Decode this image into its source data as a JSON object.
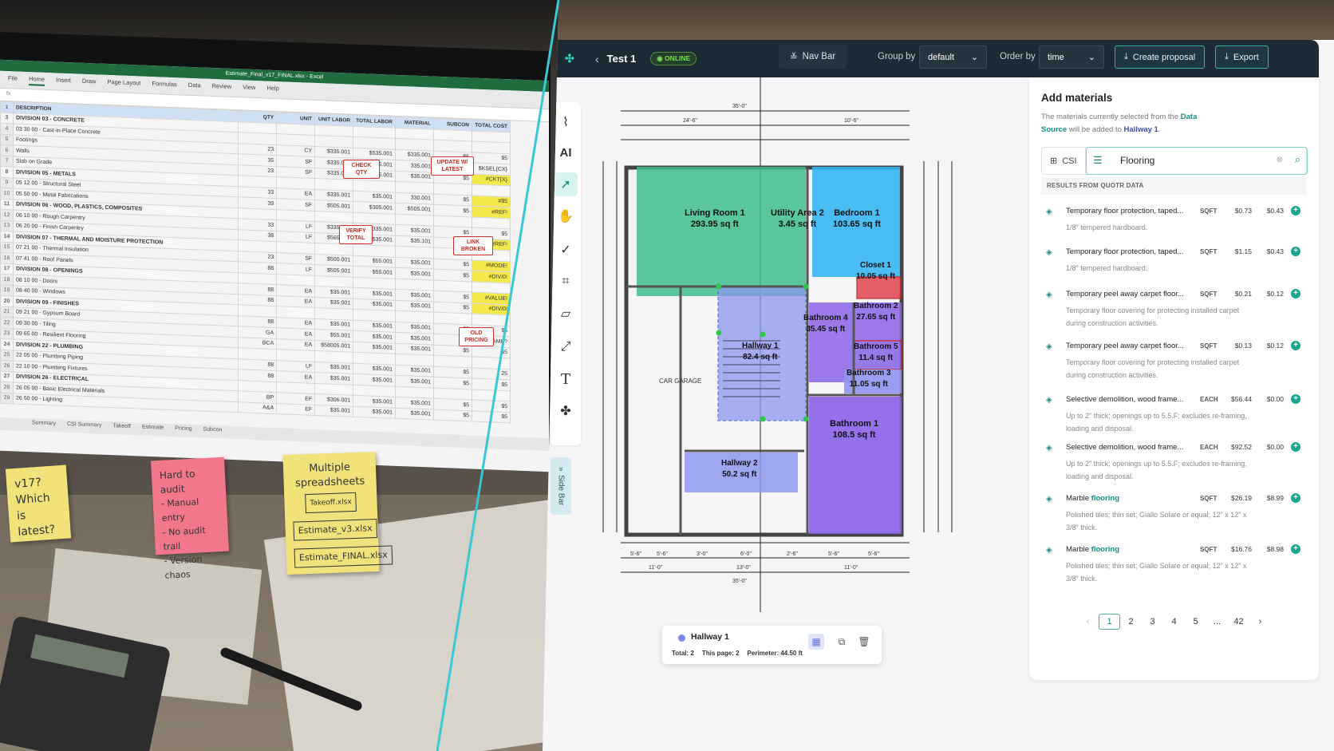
{
  "photo": {
    "excel": {
      "window_title": "Estimate_Final_v17_FINAL.xlsx - Excel",
      "ribbon_tabs": [
        "File",
        "Home",
        "Insert",
        "Draw",
        "Page Layout",
        "Formulas",
        "Data",
        "Review",
        "View",
        "Help"
      ],
      "active_tab": "Home",
      "headers": [
        "DESCRIPTION",
        "QTY",
        "UNIT",
        "UNIT LABOR",
        "TOTAL LABOR",
        "MATERIAL",
        "SUBCON",
        "TOTAL COST"
      ],
      "rows": [
        {
          "n": "3",
          "desc": "DIVISION 03 - CONCRETE",
          "div": true
        },
        {
          "n": "4",
          "desc": "03 30 00 - Cast-in-Place Concrete",
          "div": false
        },
        {
          "n": "5",
          "desc": "Footings",
          "qty": "23",
          "unit": "CY",
          "ul": "$335.001",
          "tl": "$535.001",
          "mat": "$335.001",
          "sub": "$5",
          "tot": "$5"
        },
        {
          "n": "6",
          "desc": "Walls",
          "qty": "35",
          "unit": "SF",
          "ul": "$335.001",
          "tl": "$335.001",
          "mat": "335.001",
          "sub": "$5",
          "tot": "$KSEL{CX}"
        },
        {
          "n": "7",
          "desc": "Slab on Grade",
          "qty": "23",
          "unit": "SF",
          "ul": "$335.001",
          "tl": "$335.001",
          "mat": "$35.001",
          "sub": "$5",
          "tot": "#CKT{X}"
        },
        {
          "n": "8",
          "desc": "DIVISION 05 - METALS",
          "div": true
        },
        {
          "n": "9",
          "desc": "05 12 00 - Structural Steel",
          "qty": "33",
          "unit": "EA",
          "ul": "$335.001",
          "tl": "$35.001",
          "mat": "330.001",
          "sub": "$5",
          "tot": "#$5"
        },
        {
          "n": "10",
          "desc": "05 50 00 - Metal Fabrications",
          "qty": "39",
          "unit": "SF",
          "ul": "$505.001",
          "tl": "$305.001",
          "mat": "$505.001",
          "sub": "$5",
          "tot": "#REF!"
        },
        {
          "n": "11",
          "desc": "DIVISION 06 - WOOD, PLASTICS, COMPOSITES",
          "div": true
        },
        {
          "n": "12",
          "desc": "06 10 00 - Rough Carpentry",
          "qty": "33",
          "unit": "LF",
          "ul": "$335.001",
          "tl": "$335.001",
          "mat": "$35.001",
          "sub": "$5",
          "tot": "$5"
        },
        {
          "n": "13",
          "desc": "06 20 00 - Finish Carpentry",
          "qty": "38",
          "unit": "LF",
          "ul": "$565.001",
          "tl": "$35.001",
          "mat": "$35.101",
          "sub": "$5",
          "tot": "#REF!"
        },
        {
          "n": "14",
          "desc": "DIVISION 07 - THERMAL AND MOISTURE PROTECTION",
          "div": true
        },
        {
          "n": "15",
          "desc": "07 21 00 - Thermal Insulation",
          "qty": "23",
          "unit": "SF",
          "ul": "$500.001",
          "tl": "$55.001",
          "mat": "$35.001",
          "sub": "$5",
          "tot": "#MODE!"
        },
        {
          "n": "16",
          "desc": "07 41 00 - Roof Panels",
          "qty": "88",
          "unit": "LF",
          "ul": "$505.001",
          "tl": "$55.001",
          "mat": "$35.001",
          "sub": "$5",
          "tot": "#DIV/0!"
        },
        {
          "n": "17",
          "desc": "DIVISION 08 - OPENINGS",
          "div": true
        },
        {
          "n": "18",
          "desc": "08 10 00 - Doors",
          "qty": "88",
          "unit": "EA",
          "ul": "$35.001",
          "tl": "$35.001",
          "mat": "$35.001",
          "sub": "$5",
          "tot": "#VALUE!"
        },
        {
          "n": "19",
          "desc": "08 40 00 - Windows",
          "qty": "88",
          "unit": "EA",
          "ul": "$35.001",
          "tl": "$35.001",
          "mat": "$35.001",
          "sub": "$5",
          "tot": "#DIV/0!"
        },
        {
          "n": "20",
          "desc": "DIVISION 09 - FINISHES",
          "div": true
        },
        {
          "n": "21",
          "desc": "09 21 00 - Gypsum Board",
          "qty": "88",
          "unit": "EA",
          "ul": "$35.001",
          "tl": "$35.001",
          "mat": "$35.001",
          "sub": "$5",
          "tot": "$5"
        },
        {
          "n": "22",
          "desc": "09 30 00 - Tiling",
          "qty": "GA",
          "unit": "EA",
          "ul": "$55.001",
          "tl": "$35.001",
          "mat": "$35.001",
          "sub": "$5",
          "tot": "$NAME?"
        },
        {
          "n": "23",
          "desc": "09 65 00 - Resilient Flooring",
          "qty": "BCA",
          "unit": "EA",
          "ul": "$58005.001",
          "tl": "$35.001",
          "mat": "$35.001",
          "sub": "$5",
          "tot": "$5"
        },
        {
          "n": "24",
          "desc": "DIVISION 22 - PLUMBING",
          "div": true
        },
        {
          "n": "25",
          "desc": "22 05 00 - Plumbing Piping",
          "qty": "88",
          "unit": "LF",
          "ul": "$35.001",
          "tl": "$35.001",
          "mat": "$35.001",
          "sub": "$5",
          "tot": "25"
        },
        {
          "n": "26",
          "desc": "22 10 00 - Plumbing Fixtures",
          "qty": "88",
          "unit": "EA",
          "ul": "$35.001",
          "tl": "$35.001",
          "mat": "$35.001",
          "sub": "$5",
          "tot": "$5"
        },
        {
          "n": "27",
          "desc": "DIVISION 26 - ELECTRICAL",
          "div": true
        },
        {
          "n": "28",
          "desc": "26 05 00 - Basic Electrical Materials",
          "qty": "BP",
          "unit": "EF",
          "ul": "$306.001",
          "tl": "$35.001",
          "mat": "$35.001",
          "sub": "$5",
          "tot": "$5"
        },
        {
          "n": "29",
          "desc": "26 50 00 - Lighting",
          "qty": "A&A",
          "unit": "EF",
          "ul": "$35.001",
          "tl": "$35.001",
          "mat": "$35.001",
          "sub": "$5",
          "tot": "$5"
        }
      ],
      "sheet_tabs": [
        "Summary",
        "CSI Summary",
        "Takeoff",
        "Estimate",
        "Pricing",
        "Subcon"
      ],
      "callouts": [
        "CHECK QTY",
        "UPDATE W/ LATEST",
        "VERIFY TOTAL",
        "LINK BROKEN",
        "OLD PRICING"
      ]
    },
    "notes": {
      "n1_lines": [
        "v17?",
        "Which is",
        "latest?"
      ],
      "n2_title": "Hard to audit",
      "n2_lines": [
        "- Manual entry",
        "- No audit trail",
        "- Version chaos"
      ],
      "n3_title": "Multiple spreadsheets",
      "n3_files": [
        "Takeoff.xlsx",
        "Estimate_v3.xlsx",
        "Estimate_FINAL.xlsx"
      ]
    }
  },
  "app": {
    "title": "Test 1",
    "status": "ONLINE",
    "nav_bar_label": "Nav Bar",
    "group_by_label": "Group by",
    "group_by_value": "default",
    "order_by_label": "Order by",
    "order_by_value": "time",
    "create_proposal_label": "Create proposal",
    "export_label": "Export",
    "side_bar_label": "Side Bar",
    "tools": [
      "attach",
      "AI",
      "select",
      "pan",
      "check",
      "area",
      "shape",
      "scale",
      "text",
      "count"
    ],
    "rooms": [
      {
        "name": "Living Room 1",
        "area": "293.95 sq ft"
      },
      {
        "name": "Utility Area 2",
        "area": "3.45 sq ft"
      },
      {
        "name": "Bedroom 1",
        "area": "103.65 sq ft"
      },
      {
        "name": "Closet 1",
        "area": "10.05 sq ft"
      },
      {
        "name": "Bathroom 2",
        "area": "27.65 sq ft"
      },
      {
        "name": "Bathroom 4",
        "area": "35.45 sq ft"
      },
      {
        "name": "Bathroom 5",
        "area": "11.4 sq ft"
      },
      {
        "name": "Bathroom 3",
        "area": "11.05 sq ft"
      },
      {
        "name": "Hallway 1",
        "area": "82.4 sq ft"
      },
      {
        "name": "Hallway 2",
        "area": "50.2 sq ft"
      },
      {
        "name": "Bathroom 1",
        "area": "108.5 sq ft"
      }
    ],
    "plan_text": {
      "car_garage": "CAR GARAGE",
      "dims_top": [
        "35'-0\"",
        "24'-6\"",
        "10'-6\""
      ],
      "dims_bottom": [
        "5'-6\"",
        "5'-6\"",
        "3'-0\"",
        "6'-0\"",
        "2'-6\"",
        "5'-6\"",
        "5'-6\"",
        "11'-0\"",
        "13'-0\"",
        "11'-0\"",
        "35'-0\""
      ]
    },
    "selection": {
      "name": "Hallway 1",
      "total": "Total: 2",
      "this_page": "This page: 2",
      "perimeter": "Perimeter: 44.50 ft"
    },
    "panel": {
      "title": "Add materials",
      "desc_pre": "The materials currently selected from the",
      "desc_link": "Data Source",
      "desc_mid": " will be added to ",
      "desc_target": "Hallway 1",
      "csi_label": "CSI",
      "search_value": "Flooring",
      "results_header": "RESULTS FROM QUOTR DATA",
      "items": [
        {
          "name": "Temporary floor protection, taped...",
          "unit": "SQFT",
          "p1": "$0.73",
          "p2": "$0.43",
          "desc": "1/8\" tempered hardboard."
        },
        {
          "name": "Temporary floor protection, taped...",
          "unit": "SQFT",
          "p1": "$1.15",
          "p2": "$0.43",
          "desc": "1/8\" tempered hardboard."
        },
        {
          "name": "Temporary peel away carpet floor...",
          "unit": "SQFT",
          "p1": "$0.21",
          "p2": "$0.12",
          "desc": "Temporary floor covering for protecting installed carpet during construction activities."
        },
        {
          "name": "Temporary peel away carpet floor...",
          "unit": "SQFT",
          "p1": "$0.13",
          "p2": "$0.12",
          "desc": "Temporary floor covering for protecting installed carpet during construction activities."
        },
        {
          "name": "Selective demolition, wood frame...",
          "unit": "EACH",
          "p1": "$56.44",
          "p2": "$0.00",
          "desc": "Up to 2\" thick; openings up to 5.5.F; excludes re-framing, loading and disposal."
        },
        {
          "name": "Selective demolition, wood frame...",
          "unit": "EACH",
          "p1": "$92.52",
          "p2": "$0.00",
          "desc": "Up to 2\" thick; openings up to 5.5.F; excludes re-framing, loading and disposal."
        },
        {
          "name": "Marble",
          "hl": "flooring",
          "unit": "SQFT",
          "p1": "$26.19",
          "p2": "$8.99",
          "desc": "Polished tiles; thin set; Giallo Solare or equal; 12\" x 12\" x 3/8\" thick."
        },
        {
          "name": "Marble",
          "hl": "flooring",
          "unit": "SQFT",
          "p1": "$16.76",
          "p2": "$8.98",
          "desc": "Polished tiles; thin set; Giallo Solare or equal; 12\" x 12\" x 3/8\" thick."
        }
      ],
      "pages": [
        "1",
        "2",
        "3",
        "4",
        "5",
        "...",
        "42"
      ],
      "current_page": "1"
    },
    "colors": {
      "green_room": "#3dbd8e",
      "blue_room": "#36b6f2",
      "purple_room": "#8a63e8",
      "lavender_room": "#8e96f0",
      "red_room": "#e0464f",
      "accent": "#168c80",
      "divider": "#38c8d8"
    }
  }
}
